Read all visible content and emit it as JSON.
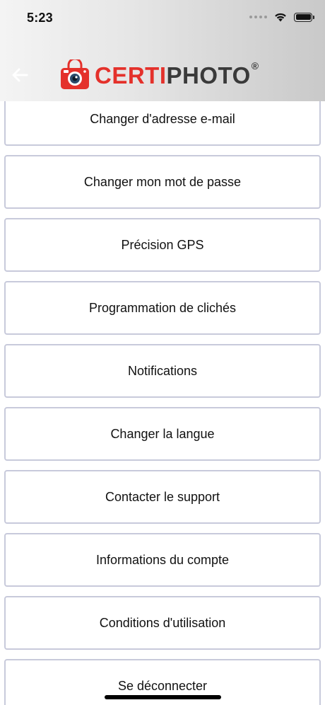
{
  "status_bar": {
    "time": "5:23"
  },
  "header": {
    "logo": {
      "part1": "CERTI",
      "part2": "PHOTO",
      "registered": "®"
    }
  },
  "menu": {
    "items": [
      {
        "label": "Changer d'adresse e-mail"
      },
      {
        "label": "Changer mon mot de passe"
      },
      {
        "label": "Précision GPS"
      },
      {
        "label": "Programmation de clichés"
      },
      {
        "label": "Notifications"
      },
      {
        "label": "Changer la langue"
      },
      {
        "label": "Contacter le support"
      },
      {
        "label": "Informations du compte"
      },
      {
        "label": "Conditions d'utilisation"
      },
      {
        "label": "Se déconnecter"
      }
    ]
  },
  "colors": {
    "brand_red": "#e4312b",
    "brand_dark": "#3a3a3a",
    "item_border": "#c8cadb"
  },
  "icons": [
    "back-arrow-icon",
    "camera-logo-icon",
    "wifi-icon",
    "battery-icon",
    "signal-icon"
  ]
}
